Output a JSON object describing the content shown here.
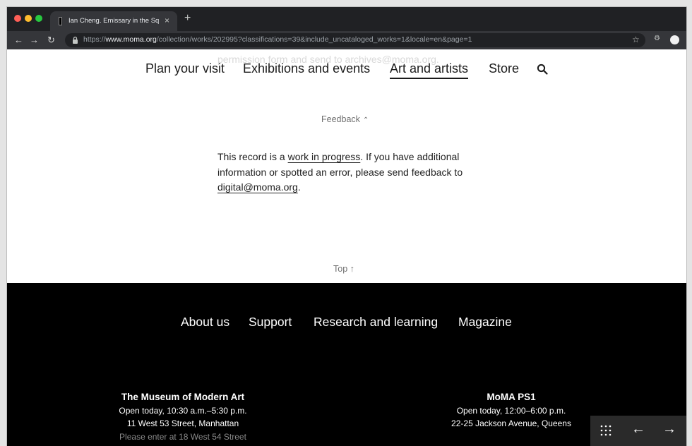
{
  "browser": {
    "tab_title": "Ian Cheng. Emissary in the Squ",
    "tab_close": "×",
    "new_tab": "+",
    "url_scheme": "https://",
    "url_host": "www.moma.org",
    "url_path": "/collection/works/202995?classifications=39&include_uncataloged_works=1&locale=en&page=1"
  },
  "header": {
    "ghost_text": "permission form and send to archives@moma.org.",
    "nav": [
      "Plan your visit",
      "Exhibitions and events",
      "Art and artists",
      "Store"
    ],
    "active_nav": "Art and artists"
  },
  "content": {
    "feedback_label": "Feedback",
    "record_pre": "This record is a ",
    "record_link": "work in progress",
    "record_mid": ". If you have additional information or spotted an error, please send feedback to ",
    "record_email": "digital@moma.org",
    "record_end": ".",
    "top_label": "Top"
  },
  "footer": {
    "links": [
      "About us",
      "Support",
      "Research and learning",
      "Magazine"
    ],
    "moma": {
      "name": "The Museum of Modern Art",
      "hours": "Open today, 10:30 a.m.–5:30 p.m.",
      "address": "11 West 53 Street, Manhattan",
      "note": "Please enter at 18 West 54 Street"
    },
    "ps1": {
      "name": "MoMA PS1",
      "hours": "Open today, 12:00–6:00 p.m.",
      "address": "22-25 Jackson Avenue, Queens"
    }
  },
  "colors": {
    "footer_bg": "#000000",
    "chrome_bg": "#202124",
    "text": "#1a1a1a"
  },
  "icons": [
    "lock-icon",
    "star-icon",
    "search-icon",
    "grid-icon",
    "arrow-left-icon",
    "arrow-right-icon"
  ]
}
